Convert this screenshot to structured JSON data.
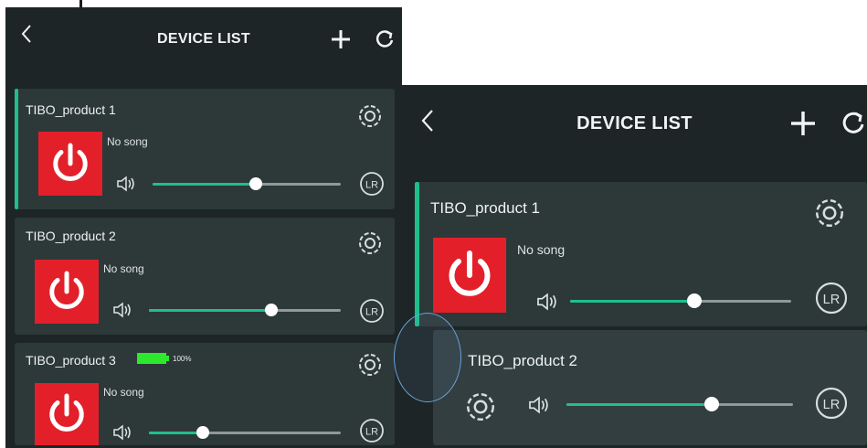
{
  "screens": [
    {
      "header": {
        "title": "DEVICE LIST",
        "back_icon": "chevron-left-icon",
        "add_icon": "plus-icon",
        "refresh_icon": "refresh-icon"
      },
      "devices": [
        {
          "name": "TIBO_product 1",
          "song": "No song",
          "volume": 0.55,
          "selected": true
        },
        {
          "name": "TIBO_product 2",
          "song": "No song",
          "volume": 0.64
        },
        {
          "name": "TIBO_product 3",
          "song": "No song",
          "volume": 0.28,
          "battery": "100%"
        }
      ]
    },
    {
      "header": {
        "title": "DEVICE LIST",
        "back_icon": "chevron-left-icon",
        "add_icon": "plus-icon",
        "refresh_icon": "refresh-icon"
      },
      "devices": [
        {
          "name": "TIBO_product 1",
          "song": "No song",
          "volume": 0.56,
          "selected": true
        },
        {
          "name": "TIBO_product 2",
          "volume": 0.64
        }
      ]
    }
  ],
  "labels": {
    "lr": "LR"
  },
  "colors": {
    "background": "#1d2526",
    "card": "#2d3839",
    "accent": "#1fbf8a",
    "power": "#e3202a",
    "battery": "#2ee82e"
  }
}
